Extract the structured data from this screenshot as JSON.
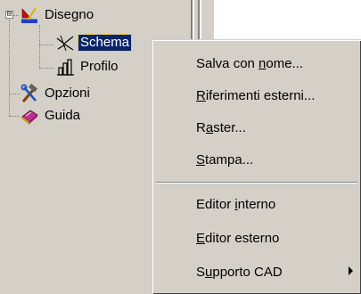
{
  "tree": {
    "expander": "⊟",
    "nodes": [
      {
        "label": "Disegno",
        "icon": "drafting-tools-icon"
      },
      {
        "label": "Schema",
        "icon": "schema-lines-icon",
        "selected": true
      },
      {
        "label": "Profilo",
        "icon": "profile-bars-icon"
      },
      {
        "label": "Opzioni",
        "icon": "hammer-wrench-icon"
      },
      {
        "label": "Guida",
        "icon": "help-book-icon"
      }
    ]
  },
  "context_menu": {
    "items": [
      {
        "pre": "Salva con ",
        "key": "n",
        "post": "ome..."
      },
      {
        "pre": "",
        "key": "R",
        "post": "iferimenti esterni..."
      },
      {
        "pre": "R",
        "key": "a",
        "post": "ster..."
      },
      {
        "pre": "",
        "key": "S",
        "post": "tampa..."
      },
      {
        "pre": "Editor ",
        "key": "i",
        "post": "nterno"
      },
      {
        "pre": "",
        "key": "E",
        "post": "ditor esterno"
      },
      {
        "pre": "S",
        "key": "u",
        "post": "pporto CAD",
        "submenu": true
      }
    ]
  }
}
